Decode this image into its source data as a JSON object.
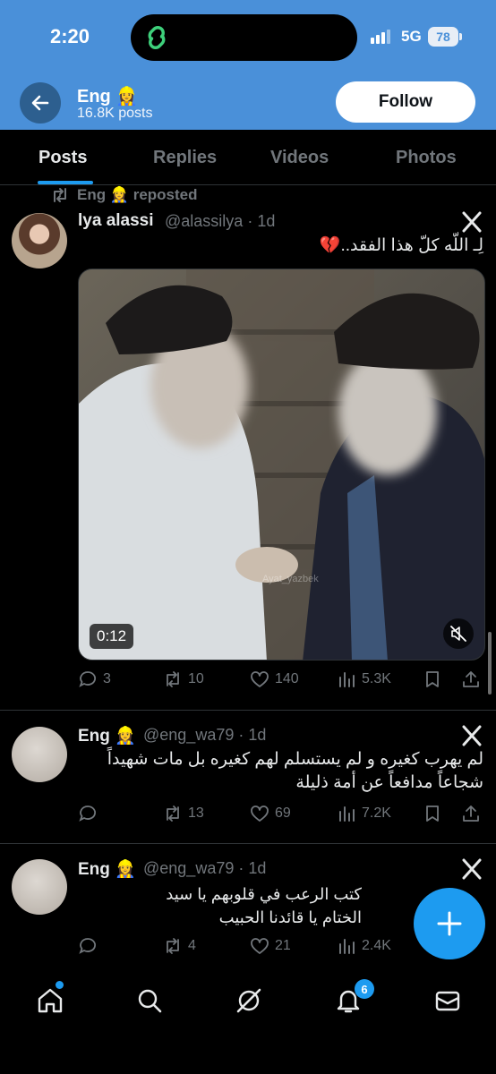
{
  "status_bar": {
    "time": "2:20",
    "network": "5G",
    "battery": "78"
  },
  "header": {
    "name": "Eng 👷‍♀️",
    "posts_count": "16.8K posts",
    "follow_label": "Follow",
    "back_icon": "arrow-left-icon",
    "banner_color": "#4a90d9"
  },
  "tabs": [
    {
      "label": "Posts",
      "active": true
    },
    {
      "label": "Replies",
      "active": false
    },
    {
      "label": "Videos",
      "active": false
    },
    {
      "label": "Photos",
      "active": false
    }
  ],
  "repost_notice": "Eng 👷‍♀️ reposted",
  "tweets": [
    {
      "name": "lya alassi",
      "handle": "@alassilya",
      "time": "1d",
      "text": "لِـ اللّه كلّ هذا الفقد..💔",
      "media": {
        "type": "video",
        "duration": "0:12",
        "watermark": "Ayat_yazbek"
      },
      "stats": {
        "replies": "3",
        "reposts": "10",
        "likes": "140",
        "views": "5.3K"
      }
    },
    {
      "name": "Eng 👷‍♀️",
      "handle": "@eng_wa79",
      "time": "1d",
      "text_lines": [
        "لم يهرب كغيره و لم يستسلم لهم كغيره بل مات شهيداً",
        "شجاعاً مدافعاً عن أمة ذليلة"
      ],
      "stats": {
        "replies": "",
        "reposts": "13",
        "likes": "69",
        "views": "7.2K"
      }
    },
    {
      "name": "Eng 👷‍♀️",
      "handle": "@eng_wa79",
      "time": "1d",
      "text_lines": [
        "كتب الرعب في قلوبهم يا سيد",
        "الختام يا قائدنا الحبيب"
      ],
      "stats": {
        "replies": "",
        "reposts": "4",
        "likes": "21",
        "views": "2.4K"
      }
    }
  ],
  "bottom_nav": {
    "items": [
      "home-icon",
      "search-icon",
      "grok-icon",
      "notifications-icon",
      "messages-icon"
    ],
    "notifications_badge": "6"
  },
  "accent_color": "#1d9bf0"
}
